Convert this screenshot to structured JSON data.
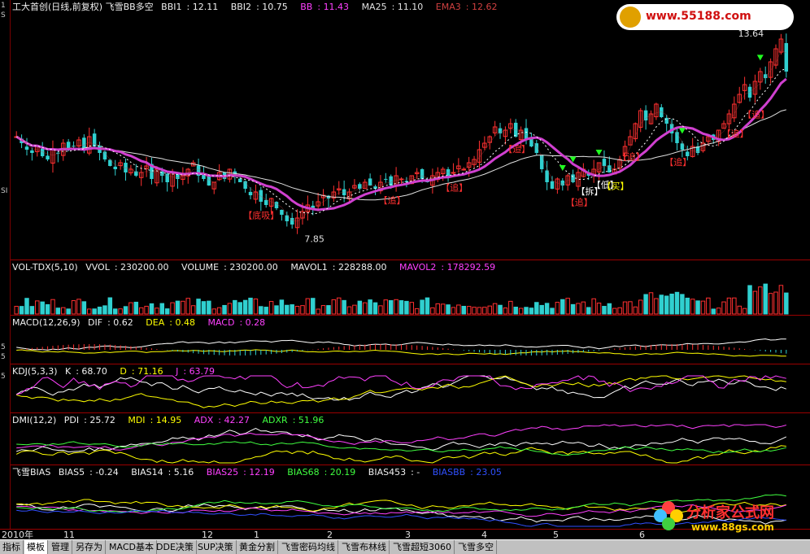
{
  "left_axis_ticks": [
    "1",
    "S",
    "",
    "",
    "",
    "",
    "",
    "",
    "",
    "",
    "",
    "",
    "",
    "",
    "",
    "",
    "",
    "",
    "",
    "SI",
    "",
    "",
    "",
    "",
    "",
    "",
    "",
    "",
    "",
    "",
    "",
    "",
    "",
    "",
    "",
    "5",
    "5",
    "",
    "5",
    "",
    "",
    "",
    "",
    "",
    "",
    "",
    "",
    "",
    "",
    "",
    ""
  ],
  "chart_data": [
    {
      "type": "candlestick",
      "pane": "main",
      "title": "工大首创(日线,前复权) 飞雪BB多空",
      "indicators": [
        {
          "name": "BBI1",
          "value": "12.11"
        },
        {
          "name": "BBI2",
          "value": "10.75"
        },
        {
          "name": "BB",
          "value": "11.43"
        },
        {
          "name": "MA25",
          "value": "11.10"
        },
        {
          "name": "EMA3",
          "value": "12.62"
        }
      ],
      "high_label": "13.64",
      "low_label": "7.85",
      "ylim": [
        7.3,
        14.3
      ],
      "closes": [
        10.6,
        10.4,
        10.2,
        10.1,
        10.3,
        10.0,
        9.9,
        10.2,
        10.1,
        10.4,
        10.2,
        10.3,
        10.5,
        10.2,
        10.6,
        10.3,
        10.1,
        9.9,
        9.7,
        9.6,
        9.8,
        9.5,
        9.6,
        9.4,
        9.5,
        9.7,
        9.3,
        9.6,
        9.4,
        9.2,
        9.5,
        9.3,
        9.4,
        9.6,
        9.8,
        9.4,
        9.3,
        9.1,
        9.2,
        9.5,
        9.3,
        9.6,
        9.4,
        9.2,
        9.0,
        8.8,
        8.9,
        8.6,
        8.5,
        8.7,
        8.4,
        8.2,
        8.0,
        7.9,
        8.1,
        8.3,
        8.5,
        8.4,
        8.6,
        8.8,
        8.7,
        8.9,
        9.0,
        8.8,
        8.9,
        9.1,
        9.0,
        9.2,
        9.1,
        9.0,
        9.2,
        9.3,
        9.1,
        9.4,
        9.3,
        9.2,
        9.4,
        9.5,
        9.3,
        9.2,
        9.4,
        9.5,
        9.6,
        9.4,
        9.5,
        9.7,
        9.6,
        9.8,
        9.9,
        10.2,
        10.4,
        10.6,
        10.9,
        10.7,
        10.8,
        11.0,
        10.6,
        10.8,
        10.5,
        10.3,
        10.1,
        9.6,
        9.2,
        9.0,
        9.3,
        9.1,
        9.4,
        9.2,
        9.5,
        9.6,
        9.4,
        9.6,
        9.8,
        9.7,
        9.5,
        9.6,
        9.9,
        10.3,
        10.6,
        11.0,
        11.4,
        11.1,
        11.3,
        11.6,
        11.2,
        11.0,
        10.7,
        10.4,
        10.2,
        10.0,
        10.3,
        10.1,
        10.4,
        10.6,
        10.5,
        10.8,
        11.0,
        11.3,
        11.6,
        11.9,
        12.2,
        11.8,
        12.3,
        12.6,
        12.4,
        12.9,
        13.3,
        13.6,
        12.6
      ],
      "annotations": [
        "【追】",
        "【追】",
        "【追】",
        "【追】",
        "【追】",
        "【追】",
        "【追】",
        "【底吸】",
        "【拆】",
        "【低】",
        "【买】",
        "【追】"
      ]
    },
    {
      "type": "bar",
      "pane": "volume",
      "title": "VOL-TDX(5,10)",
      "indicators": [
        {
          "name": "VVOL",
          "value": "230200.00"
        },
        {
          "name": "VOLUME",
          "value": "230200.00"
        },
        {
          "name": "MAVOL1",
          "value": "228288.00"
        },
        {
          "name": "MAVOL2",
          "value": "178292.59"
        }
      ]
    },
    {
      "type": "line",
      "pane": "macd",
      "title": "MACD(12,26,9)",
      "indicators": [
        {
          "name": "DIF",
          "value": "0.62"
        },
        {
          "name": "DEA",
          "value": "0.48"
        },
        {
          "name": "MACD",
          "value": "0.28"
        }
      ]
    },
    {
      "type": "line",
      "pane": "kdj",
      "title": "KDJ(5,3,3)",
      "indicators": [
        {
          "name": "K",
          "value": "68.70"
        },
        {
          "name": "D",
          "value": "71.16"
        },
        {
          "name": "J",
          "value": "63.79"
        }
      ]
    },
    {
      "type": "line",
      "pane": "dmi",
      "title": "DMI(12,2)",
      "indicators": [
        {
          "name": "PDI",
          "value": "25.72"
        },
        {
          "name": "MDI",
          "value": "14.95"
        },
        {
          "name": "ADX",
          "value": "42.27"
        },
        {
          "name": "ADXR",
          "value": "51.96"
        }
      ]
    },
    {
      "type": "line",
      "pane": "bias",
      "title": "飞雪BIAS",
      "indicators": [
        {
          "name": "BIAS5",
          "value": "-0.24"
        },
        {
          "name": "BIAS14",
          "value": "5.16"
        },
        {
          "name": "BIAS25",
          "value": "12.19"
        },
        {
          "name": "BIAS68",
          "value": "20.19"
        },
        {
          "name": "BIAS453",
          "value": "-"
        },
        {
          "name": "BIASBB",
          "value": "23.05"
        }
      ]
    }
  ],
  "date_axis": [
    "2010年",
    "11",
    "12",
    "1",
    "2",
    "3",
    "4",
    "5",
    "6"
  ],
  "tabs": [
    "指标",
    "模板",
    "管理",
    "另存为",
    "MACD基本",
    "DDE决策",
    "SUP决策",
    "黄金分割",
    "飞雪密码均线",
    "飞雪布林线",
    "飞雪超短3060",
    "飞雪多空"
  ],
  "active_tab": "模板",
  "watermark_top": "www.55188.com",
  "watermark_bottom": {
    "line1": "分析家公式网",
    "line2": "www.88gs.com"
  },
  "colors": {
    "up": "#ff3030",
    "down": "#30d0d0",
    "bb": "#d040d0",
    "grid": "#9a0000",
    "background": "#000000"
  }
}
